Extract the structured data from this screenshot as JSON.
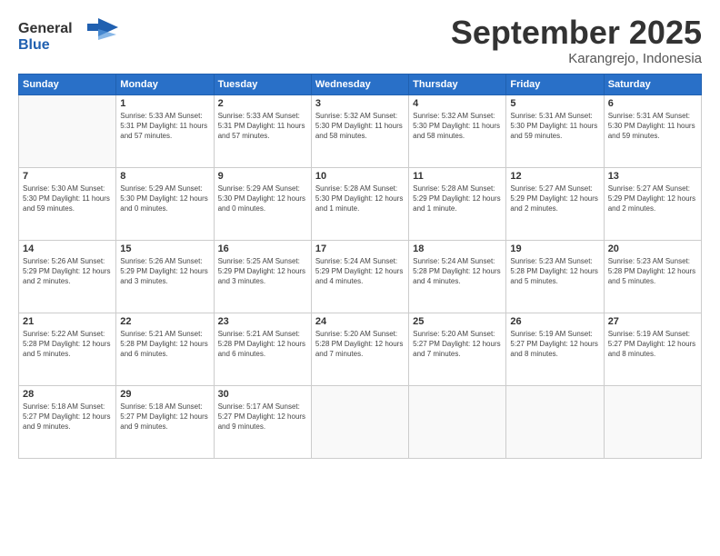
{
  "logo": {
    "line1": "General",
    "line2": "Blue"
  },
  "title": "September 2025",
  "subtitle": "Karangrejo, Indonesia",
  "header": {
    "days": [
      "Sunday",
      "Monday",
      "Tuesday",
      "Wednesday",
      "Thursday",
      "Friday",
      "Saturday"
    ]
  },
  "weeks": [
    [
      {
        "day": "",
        "info": ""
      },
      {
        "day": "1",
        "info": "Sunrise: 5:33 AM\nSunset: 5:31 PM\nDaylight: 11 hours\nand 57 minutes."
      },
      {
        "day": "2",
        "info": "Sunrise: 5:33 AM\nSunset: 5:31 PM\nDaylight: 11 hours\nand 57 minutes."
      },
      {
        "day": "3",
        "info": "Sunrise: 5:32 AM\nSunset: 5:30 PM\nDaylight: 11 hours\nand 58 minutes."
      },
      {
        "day": "4",
        "info": "Sunrise: 5:32 AM\nSunset: 5:30 PM\nDaylight: 11 hours\nand 58 minutes."
      },
      {
        "day": "5",
        "info": "Sunrise: 5:31 AM\nSunset: 5:30 PM\nDaylight: 11 hours\nand 59 minutes."
      },
      {
        "day": "6",
        "info": "Sunrise: 5:31 AM\nSunset: 5:30 PM\nDaylight: 11 hours\nand 59 minutes."
      }
    ],
    [
      {
        "day": "7",
        "info": "Sunrise: 5:30 AM\nSunset: 5:30 PM\nDaylight: 11 hours\nand 59 minutes."
      },
      {
        "day": "8",
        "info": "Sunrise: 5:29 AM\nSunset: 5:30 PM\nDaylight: 12 hours\nand 0 minutes."
      },
      {
        "day": "9",
        "info": "Sunrise: 5:29 AM\nSunset: 5:30 PM\nDaylight: 12 hours\nand 0 minutes."
      },
      {
        "day": "10",
        "info": "Sunrise: 5:28 AM\nSunset: 5:30 PM\nDaylight: 12 hours\nand 1 minute."
      },
      {
        "day": "11",
        "info": "Sunrise: 5:28 AM\nSunset: 5:29 PM\nDaylight: 12 hours\nand 1 minute."
      },
      {
        "day": "12",
        "info": "Sunrise: 5:27 AM\nSunset: 5:29 PM\nDaylight: 12 hours\nand 2 minutes."
      },
      {
        "day": "13",
        "info": "Sunrise: 5:27 AM\nSunset: 5:29 PM\nDaylight: 12 hours\nand 2 minutes."
      }
    ],
    [
      {
        "day": "14",
        "info": "Sunrise: 5:26 AM\nSunset: 5:29 PM\nDaylight: 12 hours\nand 2 minutes."
      },
      {
        "day": "15",
        "info": "Sunrise: 5:26 AM\nSunset: 5:29 PM\nDaylight: 12 hours\nand 3 minutes."
      },
      {
        "day": "16",
        "info": "Sunrise: 5:25 AM\nSunset: 5:29 PM\nDaylight: 12 hours\nand 3 minutes."
      },
      {
        "day": "17",
        "info": "Sunrise: 5:24 AM\nSunset: 5:29 PM\nDaylight: 12 hours\nand 4 minutes."
      },
      {
        "day": "18",
        "info": "Sunrise: 5:24 AM\nSunset: 5:28 PM\nDaylight: 12 hours\nand 4 minutes."
      },
      {
        "day": "19",
        "info": "Sunrise: 5:23 AM\nSunset: 5:28 PM\nDaylight: 12 hours\nand 5 minutes."
      },
      {
        "day": "20",
        "info": "Sunrise: 5:23 AM\nSunset: 5:28 PM\nDaylight: 12 hours\nand 5 minutes."
      }
    ],
    [
      {
        "day": "21",
        "info": "Sunrise: 5:22 AM\nSunset: 5:28 PM\nDaylight: 12 hours\nand 5 minutes."
      },
      {
        "day": "22",
        "info": "Sunrise: 5:21 AM\nSunset: 5:28 PM\nDaylight: 12 hours\nand 6 minutes."
      },
      {
        "day": "23",
        "info": "Sunrise: 5:21 AM\nSunset: 5:28 PM\nDaylight: 12 hours\nand 6 minutes."
      },
      {
        "day": "24",
        "info": "Sunrise: 5:20 AM\nSunset: 5:28 PM\nDaylight: 12 hours\nand 7 minutes."
      },
      {
        "day": "25",
        "info": "Sunrise: 5:20 AM\nSunset: 5:27 PM\nDaylight: 12 hours\nand 7 minutes."
      },
      {
        "day": "26",
        "info": "Sunrise: 5:19 AM\nSunset: 5:27 PM\nDaylight: 12 hours\nand 8 minutes."
      },
      {
        "day": "27",
        "info": "Sunrise: 5:19 AM\nSunset: 5:27 PM\nDaylight: 12 hours\nand 8 minutes."
      }
    ],
    [
      {
        "day": "28",
        "info": "Sunrise: 5:18 AM\nSunset: 5:27 PM\nDaylight: 12 hours\nand 9 minutes."
      },
      {
        "day": "29",
        "info": "Sunrise: 5:18 AM\nSunset: 5:27 PM\nDaylight: 12 hours\nand 9 minutes."
      },
      {
        "day": "30",
        "info": "Sunrise: 5:17 AM\nSunset: 5:27 PM\nDaylight: 12 hours\nand 9 minutes."
      },
      {
        "day": "",
        "info": ""
      },
      {
        "day": "",
        "info": ""
      },
      {
        "day": "",
        "info": ""
      },
      {
        "day": "",
        "info": ""
      }
    ]
  ]
}
